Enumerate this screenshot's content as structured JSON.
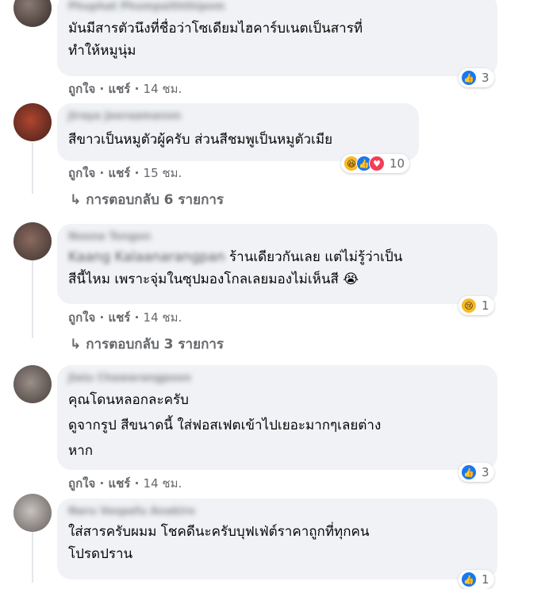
{
  "comments": [
    {
      "author": "Phuphat Phumpaiththipom",
      "text": "มันมีสารตัวนึงที่ชื่อว่าโซเดียมไฮคาร์บเนตเป็นสารที่\nทำให้หมูนุ่ม",
      "like_label": "ถูกใจ",
      "share_label": "แชร์",
      "time": "14 ชม.",
      "reaction_count": "3",
      "reaction_icons": [
        "like-icon"
      ]
    },
    {
      "author": "Jiraya Jeeraamanon",
      "text": "สีขาวเป็นหมูตัวผู้ครับ ส่วนสีชมพูเป็นหมูตัวเมีย",
      "like_label": "ถูกใจ",
      "share_label": "แชร์",
      "time": "15 ชม.",
      "reaction_count": "10",
      "reaction_icons": [
        "haha-icon",
        "like-icon",
        "love-icon"
      ],
      "replies_label": "การตอบกลับ 6 รายการ"
    },
    {
      "author": "Noona Tongon",
      "text_blurred": "Kaang Kalaanarangpan",
      "text": " ร้านเดียวกันเลย แต่ไม่รู้ว่าเป็น\nสีนี้ไหม เพราะจุ่มในซุปมองโกลเลยมองไม่เห็นสี 😭",
      "like_label": "ถูกใจ",
      "share_label": "แชร์",
      "time": "14 ชม.",
      "reaction_count": "1",
      "reaction_icons": [
        "sad-icon"
      ],
      "replies_label": "การตอบกลับ 3 รายการ"
    },
    {
      "author": "Jiaiu Chawarangpoon",
      "text": "คุณโดนหลอกละครับ\nดูจากรูป สีขนาดนี้ ใส่ฟอสเฟตเข้าไปเยอะมากๆเลยต่าง\nหาก",
      "like_label": "ถูกใจ",
      "share_label": "แชร์",
      "time": "14 ชม.",
      "reaction_count": "3",
      "reaction_icons": [
        "like-icon"
      ]
    },
    {
      "author": "Naru Vespafu Anakiro",
      "text": "ใส่สารครับผมม โชคดีนะครับบุฟเฟ่ต์ราคาถูกที่ทุกคน\nโปรดปราน",
      "reaction_count": "1",
      "reaction_icons": [
        "like-icon"
      ]
    }
  ],
  "separator": "·",
  "reply_arrow": "↳",
  "colors": {
    "bubble": "#f0f2f5",
    "meta_text": "#65676b",
    "like_blue": "#1877f2",
    "love_red": "#f33e58",
    "haha_yellow": "#f7b928"
  }
}
